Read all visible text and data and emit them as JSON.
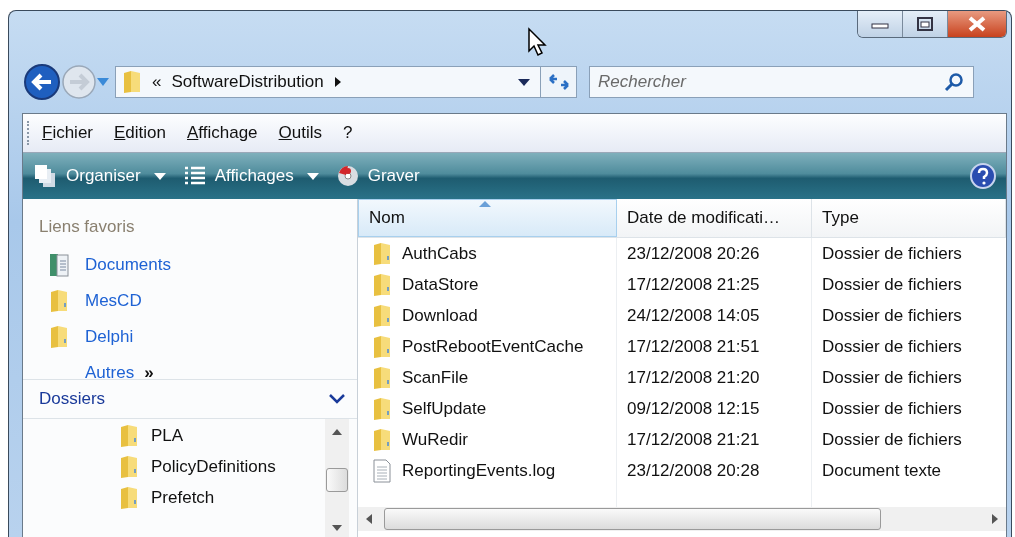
{
  "navigation": {
    "back": {
      "disabled": false
    },
    "forward": {
      "disabled": true
    }
  },
  "address": {
    "prefix": "«",
    "segment": "SoftwareDistribution"
  },
  "search": {
    "placeholder": "Rechercher"
  },
  "menu": [
    "Fichier",
    "Edition",
    "Affichage",
    "Outils",
    "?"
  ],
  "toolbar": [
    {
      "label": "Organiser",
      "kind": "organize",
      "dropdown": true
    },
    {
      "label": "Affichages",
      "kind": "views",
      "dropdown": true
    },
    {
      "label": "Graver",
      "kind": "burn",
      "dropdown": false
    }
  ],
  "favorites": {
    "title": "Liens favoris",
    "items": [
      {
        "label": "Documents",
        "kind": "documents"
      },
      {
        "label": "MesCD",
        "kind": "folder"
      },
      {
        "label": "Delphi",
        "kind": "folder"
      }
    ],
    "more": {
      "label": "Autres",
      "glyph": "»"
    }
  },
  "folders": {
    "title": "Dossiers",
    "expanded": true,
    "items": [
      "PLA",
      "PolicyDefinitions",
      "Prefetch"
    ]
  },
  "columns": [
    {
      "label": "Nom",
      "sorted": true
    },
    {
      "label": "Date de modificati…",
      "sorted": false
    },
    {
      "label": "Type",
      "sorted": false
    }
  ],
  "rows": [
    {
      "kind": "folder",
      "name": "AuthCabs",
      "date": "23/12/2008 20:26",
      "type": "Dossier de fichiers"
    },
    {
      "kind": "folder",
      "name": "DataStore",
      "date": "17/12/2008 21:25",
      "type": "Dossier de fichiers"
    },
    {
      "kind": "folder",
      "name": "Download",
      "date": "24/12/2008 14:05",
      "type": "Dossier de fichiers"
    },
    {
      "kind": "folder",
      "name": "PostRebootEventCache",
      "date": "17/12/2008 21:51",
      "type": "Dossier de fichiers"
    },
    {
      "kind": "folder",
      "name": "ScanFile",
      "date": "17/12/2008 21:20",
      "type": "Dossier de fichiers"
    },
    {
      "kind": "folder",
      "name": "SelfUpdate",
      "date": "09/12/2008 12:15",
      "type": "Dossier de fichiers"
    },
    {
      "kind": "folder",
      "name": "WuRedir",
      "date": "17/12/2008 21:21",
      "type": "Dossier de fichiers"
    },
    {
      "kind": "file",
      "name": "ReportingEvents.log",
      "date": "23/12/2008 20:28",
      "type": "Document texte"
    }
  ]
}
